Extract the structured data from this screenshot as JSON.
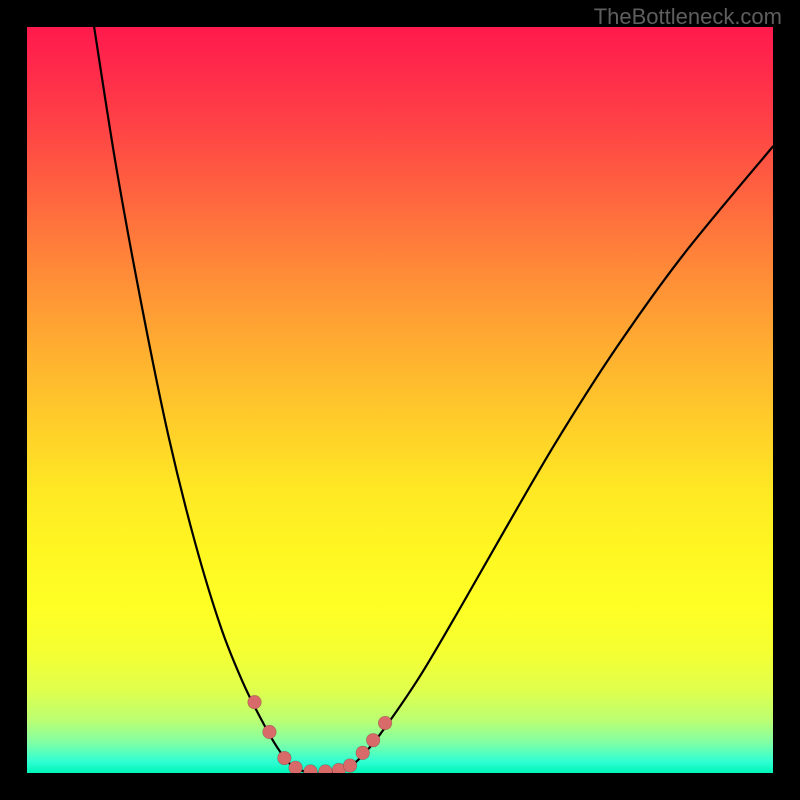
{
  "watermark": "TheBottleneck.com",
  "plot": {
    "innerWidth": 746,
    "innerHeight": 746,
    "gradient": {
      "top": "#ff1a4d",
      "mid": "#fff622",
      "bottom": "#00f5b8"
    }
  },
  "chart_data": {
    "type": "line",
    "title": "",
    "xlabel": "",
    "ylabel": "",
    "grid": false,
    "axes_visible": false,
    "x_range": [
      0,
      100
    ],
    "y_range": [
      0,
      100
    ],
    "series": [
      {
        "name": "bottleneck-curve",
        "note": "visual V-curve; x normalized 0-100 across plot width, y normalized 0-100 (0 at top, 100 at bottom)",
        "points": [
          [
            9.0,
            0.0
          ],
          [
            12.0,
            19.0
          ],
          [
            15.5,
            38.0
          ],
          [
            19.0,
            55.0
          ],
          [
            22.5,
            69.0
          ],
          [
            26.0,
            80.5
          ],
          [
            29.0,
            88.0
          ],
          [
            31.5,
            93.0
          ],
          [
            33.5,
            96.5
          ],
          [
            35.5,
            99.0
          ],
          [
            38.0,
            100.0
          ],
          [
            41.0,
            100.0
          ],
          [
            43.5,
            99.0
          ],
          [
            46.0,
            96.5
          ],
          [
            49.0,
            92.5
          ],
          [
            53.0,
            86.5
          ],
          [
            58.0,
            78.0
          ],
          [
            64.0,
            67.5
          ],
          [
            71.0,
            55.5
          ],
          [
            79.0,
            43.0
          ],
          [
            88.0,
            30.5
          ],
          [
            100.0,
            16.0
          ]
        ]
      }
    ],
    "markers": {
      "name": "highlighted-datapoints",
      "color": "#d86a6a",
      "radius": 6.8,
      "points": [
        [
          30.5,
          90.5
        ],
        [
          32.5,
          94.5
        ],
        [
          34.5,
          98.0
        ],
        [
          36.0,
          99.3
        ],
        [
          38.0,
          99.8
        ],
        [
          40.0,
          99.8
        ],
        [
          41.8,
          99.6
        ],
        [
          43.3,
          99.0
        ],
        [
          45.0,
          97.3
        ],
        [
          46.4,
          95.6
        ],
        [
          48.0,
          93.3
        ]
      ]
    }
  }
}
